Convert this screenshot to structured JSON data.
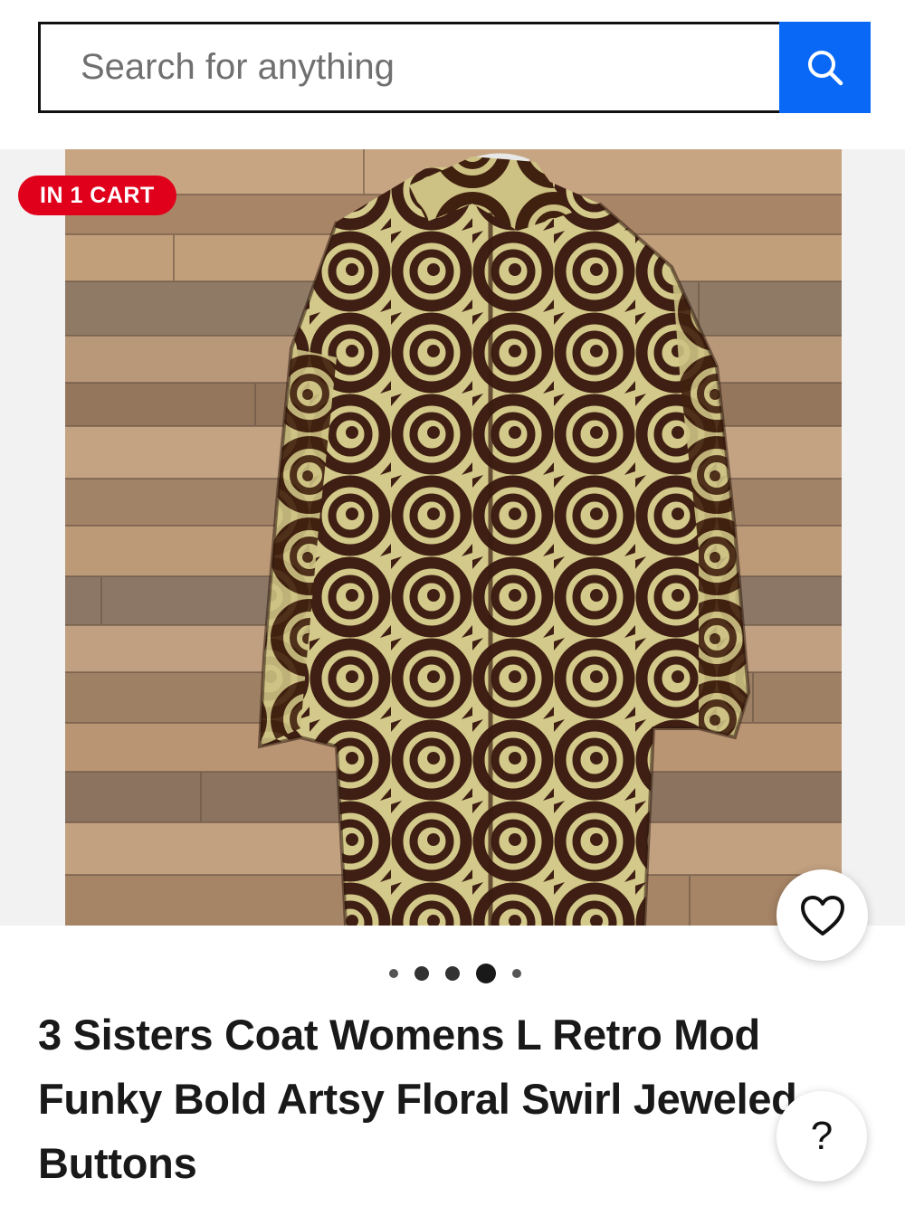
{
  "search": {
    "placeholder": "Search for anything",
    "button_icon": "search-icon",
    "button_color": "#0968f6"
  },
  "gallery": {
    "badge": "IN 1 CART",
    "badge_color": "#e0001b",
    "image_alt": "Swirl rose patterned coat hanging on a rustic wood plank wall",
    "dots_count": 5,
    "active_dot": 4
  },
  "listing": {
    "title": "3 Sisters Coat Womens L Retro Mod Funky Bold Artsy Floral Swirl Jeweled Buttons"
  },
  "actions": {
    "watch_icon": "heart-icon",
    "help_label": "?"
  }
}
